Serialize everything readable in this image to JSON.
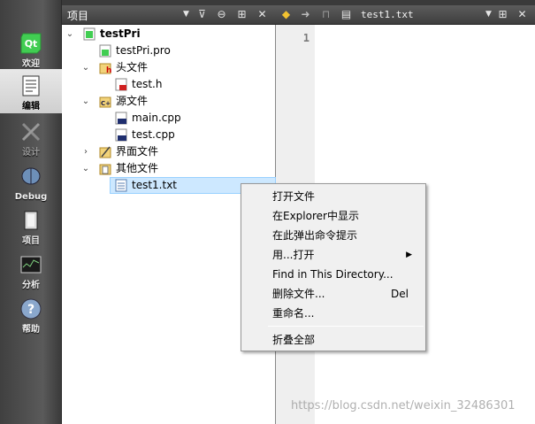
{
  "modes": [
    {
      "label": "欢迎",
      "icon": "qt-logo-icon"
    },
    {
      "label": "编辑",
      "icon": "edit-document-icon",
      "active": true
    },
    {
      "label": "设计",
      "icon": "design-tools-icon",
      "disabled": true
    },
    {
      "label": "Debug",
      "icon": "debug-icon"
    },
    {
      "label": "项目",
      "icon": "project-icon"
    },
    {
      "label": "分析",
      "icon": "analyze-icon"
    },
    {
      "label": "帮助",
      "icon": "help-icon"
    }
  ],
  "project_panel": {
    "title": "项目",
    "tree": [
      {
        "label": "testPri",
        "icon": "qt-project-icon",
        "expanded": true
      },
      {
        "label": "testPri.pro",
        "icon": "pro-file-icon"
      },
      {
        "label": "头文件",
        "icon": "header-folder-icon",
        "expanded": true
      },
      {
        "label": "test.h",
        "icon": "header-file-icon"
      },
      {
        "label": "源文件",
        "icon": "source-folder-icon",
        "expanded": true
      },
      {
        "label": "main.cpp",
        "icon": "cpp-file-icon"
      },
      {
        "label": "test.cpp",
        "icon": "cpp-file-icon"
      },
      {
        "label": "界面文件",
        "icon": "form-folder-icon",
        "expanded": false
      },
      {
        "label": "其他文件",
        "icon": "other-folder-icon",
        "expanded": true
      },
      {
        "label": "test1.txt",
        "icon": "text-file-icon",
        "selected": true
      }
    ]
  },
  "editor": {
    "file_name": "test1.txt",
    "line_number": "1"
  },
  "context_menu": {
    "items": [
      {
        "label": "打开文件"
      },
      {
        "label": "在Explorer中显示"
      },
      {
        "label": "在此弹出命令提示"
      },
      {
        "label": "用...打开",
        "submenu": true
      },
      {
        "label": "Find in This Directory..."
      },
      {
        "label": "删除文件...",
        "shortcut": "Del"
      },
      {
        "label": "重命名..."
      },
      {
        "label": "折叠全部"
      }
    ]
  },
  "watermark": "https://blog.csdn.net/weixin_32486301"
}
